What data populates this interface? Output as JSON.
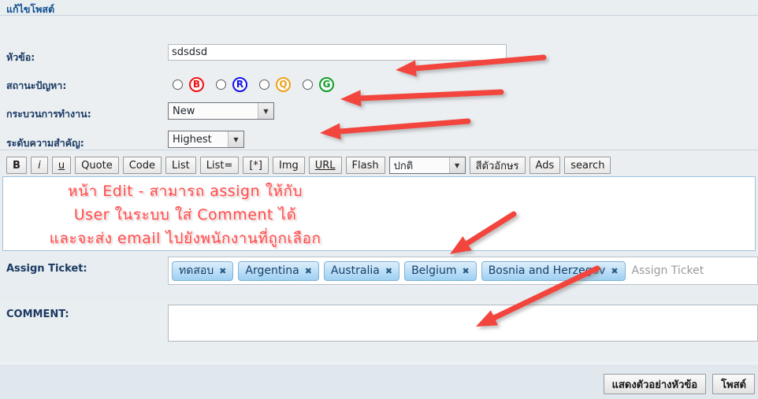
{
  "header": {
    "title": "แก้ไขโพสต์"
  },
  "form": {
    "labels": {
      "title": "หัวข้อ:",
      "status": "สถานะปัญหา:",
      "workflow": "กระบวนการทำงาน:",
      "priority": "ระดับความสำคัญ:"
    },
    "title_input": {
      "value": "sdsdsd",
      "placeholder": ""
    },
    "status_options": [
      {
        "letter": "B",
        "color": "#ee1111",
        "selected": false
      },
      {
        "letter": "R",
        "color": "#1111ee",
        "selected": false
      },
      {
        "letter": "Q",
        "color": "#f0a019",
        "selected": false
      },
      {
        "letter": "G",
        "color": "#109c26",
        "selected": false
      }
    ],
    "workflow_select": {
      "value": "New",
      "options": [
        "New"
      ]
    },
    "priority_select": {
      "value": "Highest",
      "options": [
        "Highest"
      ]
    }
  },
  "toolbar": {
    "buttons": [
      {
        "label": "B",
        "style": "bold"
      },
      {
        "label": "i",
        "style": "ital"
      },
      {
        "label": "u",
        "style": "und"
      },
      {
        "label": "Quote",
        "style": ""
      },
      {
        "label": "Code",
        "style": ""
      },
      {
        "label": "List",
        "style": ""
      },
      {
        "label": "List=",
        "style": ""
      },
      {
        "label": "[*]",
        "style": ""
      },
      {
        "label": "Img",
        "style": ""
      },
      {
        "label": "URL",
        "style": "link"
      },
      {
        "label": "Flash",
        "style": ""
      }
    ],
    "font_select": {
      "value": "ปกติ",
      "options": [
        "ปกติ"
      ]
    },
    "buttons_after": [
      {
        "label": "สีตัวอักษร",
        "style": ""
      },
      {
        "label": "Ads",
        "style": ""
      },
      {
        "label": "search",
        "style": ""
      }
    ]
  },
  "editor": {
    "value": "",
    "annotation": {
      "line1": "หน้า Edit  - สามารถ assign ให้กับ",
      "line2": "User ในระบบ ใส่ Comment ได้",
      "line3": "และจะส่ง email ไปยังพนักงานที่ถูกเลือก",
      "color": "#ff4d4d"
    }
  },
  "assign": {
    "label": "Assign Ticket:",
    "placeholder": "Assign Ticket",
    "tags": [
      {
        "text": "ทดสอบ",
        "remove": "✖"
      },
      {
        "text": "Argentina",
        "remove": "✖"
      },
      {
        "text": "Australia",
        "remove": "✖"
      },
      {
        "text": "Belgium",
        "remove": "✖"
      },
      {
        "text": "Bosnia and Herzegov",
        "remove": "✖"
      }
    ]
  },
  "comment": {
    "label": "COMMENT:",
    "value": "",
    "placeholder": ""
  },
  "footer": {
    "preview_label": "แสดงตัวอย่างหัวข้อ",
    "post_label": "โพสต์"
  },
  "annotation_arrows": {
    "color": "#f2453d",
    "count": 5
  }
}
